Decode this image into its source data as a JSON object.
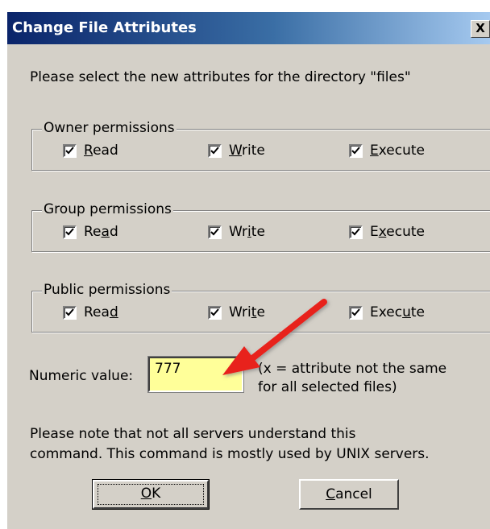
{
  "dialog": {
    "title": "Change File Attributes",
    "close_label": "X",
    "instruction": "Please select the new attributes for the directory \"files\""
  },
  "groups": [
    {
      "legend": "Owner permissions",
      "read": {
        "label_before": "",
        "mnemonic": "R",
        "label_after": "ead",
        "checked": true
      },
      "write": {
        "label_before": "",
        "mnemonic": "W",
        "label_after": "rite",
        "checked": true
      },
      "execute": {
        "label_before": "",
        "mnemonic": "E",
        "label_after": "xecute",
        "checked": true
      }
    },
    {
      "legend": "Group permissions",
      "read": {
        "label_before": "Re",
        "mnemonic": "a",
        "label_after": "d",
        "checked": true
      },
      "write": {
        "label_before": "Wr",
        "mnemonic": "i",
        "label_after": "te",
        "checked": true
      },
      "execute": {
        "label_before": "E",
        "mnemonic": "x",
        "label_after": "ecute",
        "checked": true
      }
    },
    {
      "legend": "Public permissions",
      "read": {
        "label_before": "Rea",
        "mnemonic": "d",
        "label_after": "",
        "checked": true
      },
      "write": {
        "label_before": "Wri",
        "mnemonic": "t",
        "label_after": "e",
        "checked": true
      },
      "execute": {
        "label_before": "Exec",
        "mnemonic": "u",
        "label_after": "te",
        "checked": true
      }
    }
  ],
  "numeric": {
    "label": "Numeric value:",
    "value": "777",
    "hint_line1": "(x = attribute not the same",
    "hint_line2": "for all selected files)"
  },
  "note": {
    "line1": "Please note that not all servers understand this",
    "line2": "command. This command is mostly used by UNIX servers."
  },
  "buttons": {
    "ok": {
      "before": "",
      "mnemonic": "O",
      "after": "K"
    },
    "cancel": {
      "before": "",
      "mnemonic": "C",
      "after": "ancel"
    }
  },
  "colors": {
    "dialog_bg": "#d4d0c8",
    "title_gradient_start": "#0a246a",
    "highlight": "#f8f38e",
    "input_bg": "#ffff99",
    "arrow": "#e8231c"
  }
}
